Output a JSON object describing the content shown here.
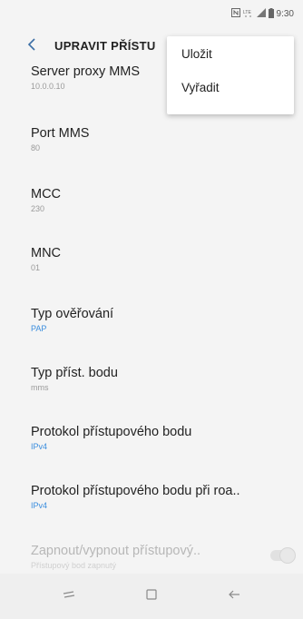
{
  "status_bar": {
    "icons": [
      "nfc-icon",
      "lte-icon",
      "signal-icon",
      "battery-icon"
    ],
    "time": "9:30"
  },
  "app_bar": {
    "title": "UPRAVIT PŘÍSTU"
  },
  "settings": [
    {
      "title": "Server proxy MMS",
      "value": "10.0.0.10",
      "accent": false,
      "disabled": false
    },
    {
      "title": "Port MMS",
      "value": "80",
      "accent": false,
      "disabled": false
    },
    {
      "title": "MCC",
      "value": "230",
      "accent": false,
      "disabled": false
    },
    {
      "title": "MNC",
      "value": "01",
      "accent": false,
      "disabled": false
    },
    {
      "title": "Typ ověřování",
      "value": "PAP",
      "accent": true,
      "disabled": false
    },
    {
      "title": "Typ příst. bodu",
      "value": "mms",
      "accent": false,
      "disabled": false
    },
    {
      "title": "Protokol přístupového bodu",
      "value": "IPv4",
      "accent": true,
      "disabled": false
    },
    {
      "title": "Protokol přístupového bodu při roa..",
      "value": "IPv4",
      "accent": true,
      "disabled": false
    },
    {
      "title": "Zapnout/vypnout přístupový..",
      "value": "Přístupový bod zapnutý",
      "accent": false,
      "disabled": true,
      "toggle": true
    }
  ],
  "menu": {
    "items": [
      "Uložit",
      "Vyřadit"
    ]
  },
  "colors": {
    "accent": "#3a8dde",
    "back_arrow": "#3b6ea5",
    "background": "#f4f4f4"
  },
  "nav_bar": {
    "icons": [
      "recent-apps-icon",
      "home-icon",
      "back-icon"
    ]
  }
}
